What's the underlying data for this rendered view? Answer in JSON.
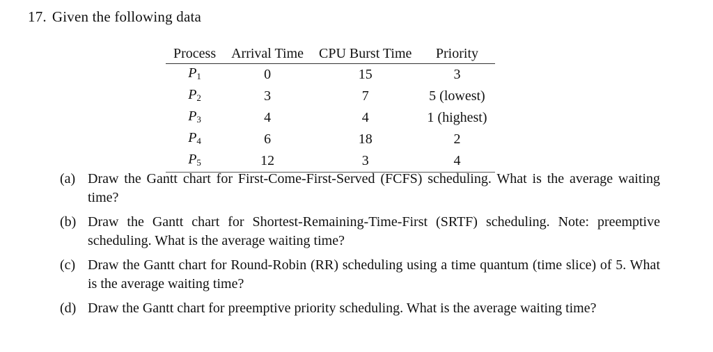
{
  "problem": {
    "number": "17.",
    "intro": "Given the following data"
  },
  "table": {
    "headers": [
      "Process",
      "Arrival Time",
      "CPU Burst Time",
      "Priority"
    ],
    "rows": [
      {
        "process": "P",
        "sub": "1",
        "arrival": "0",
        "burst": "15",
        "priority": "3"
      },
      {
        "process": "P",
        "sub": "2",
        "arrival": "3",
        "burst": "7",
        "priority": "5 (lowest)"
      },
      {
        "process": "P",
        "sub": "3",
        "arrival": "4",
        "burst": "4",
        "priority": "1 (highest)"
      },
      {
        "process": "P",
        "sub": "4",
        "arrival": "6",
        "burst": "18",
        "priority": "2"
      },
      {
        "process": "P",
        "sub": "5",
        "arrival": "12",
        "burst": "3",
        "priority": "4"
      }
    ]
  },
  "questions": [
    {
      "label": "(a)",
      "text": "Draw the Gantt chart for First-Come-First-Served (FCFS) scheduling. What is the average waiting time?"
    },
    {
      "label": "(b)",
      "text": "Draw the Gantt chart for Shortest-Remaining-Time-First (SRTF) scheduling. Note: preemptive scheduling. What is the average waiting time?"
    },
    {
      "label": "(c)",
      "text": "Draw the Gantt chart for Round-Robin (RR) scheduling using a time quantum (time slice) of 5. What is the average waiting time?"
    },
    {
      "label": "(d)",
      "text": "Draw the Gantt chart for preemptive priority scheduling. What is the average waiting time?"
    }
  ]
}
